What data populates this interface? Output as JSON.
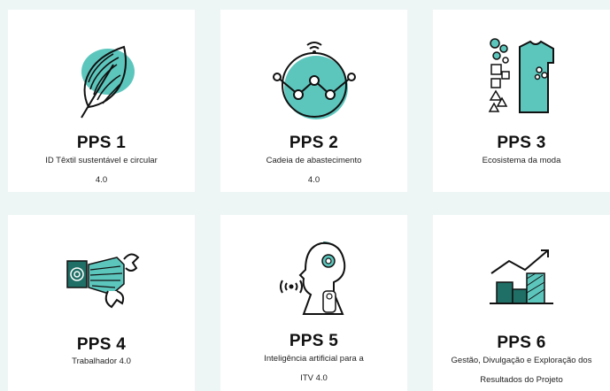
{
  "colors": {
    "accent": "#5cc6bd",
    "dark_teal": "#1f6f66",
    "stroke": "#111111",
    "background": "#eef6f5",
    "card": "#ffffff"
  },
  "cards": [
    {
      "title": "PPS 1",
      "line1": "ID Têxtil sustentável e circular",
      "line2": "4.0",
      "icon": "leaf-fingerprint-icon"
    },
    {
      "title": "PPS 2",
      "line1": "Cadeia de abastecimento",
      "line2": "4.0",
      "icon": "network-globe-icon"
    },
    {
      "title": "PPS 3",
      "line1": "Ecosistema da moda",
      "line2": "",
      "icon": "tshirt-shapes-icon"
    },
    {
      "title": "PPS 4",
      "line1": "Trabalhador 4.0",
      "line2": "",
      "icon": "robotic-hand-icon"
    },
    {
      "title": "PPS 5",
      "line1": "Inteligência artificial para a",
      "line2": "ITV 4.0",
      "icon": "ai-head-icon"
    },
    {
      "title": "PPS 6",
      "line1": "Gestão, Divulgação e Exploração dos",
      "line2": "Resultados do Projeto",
      "icon": "growth-chart-icon"
    }
  ]
}
